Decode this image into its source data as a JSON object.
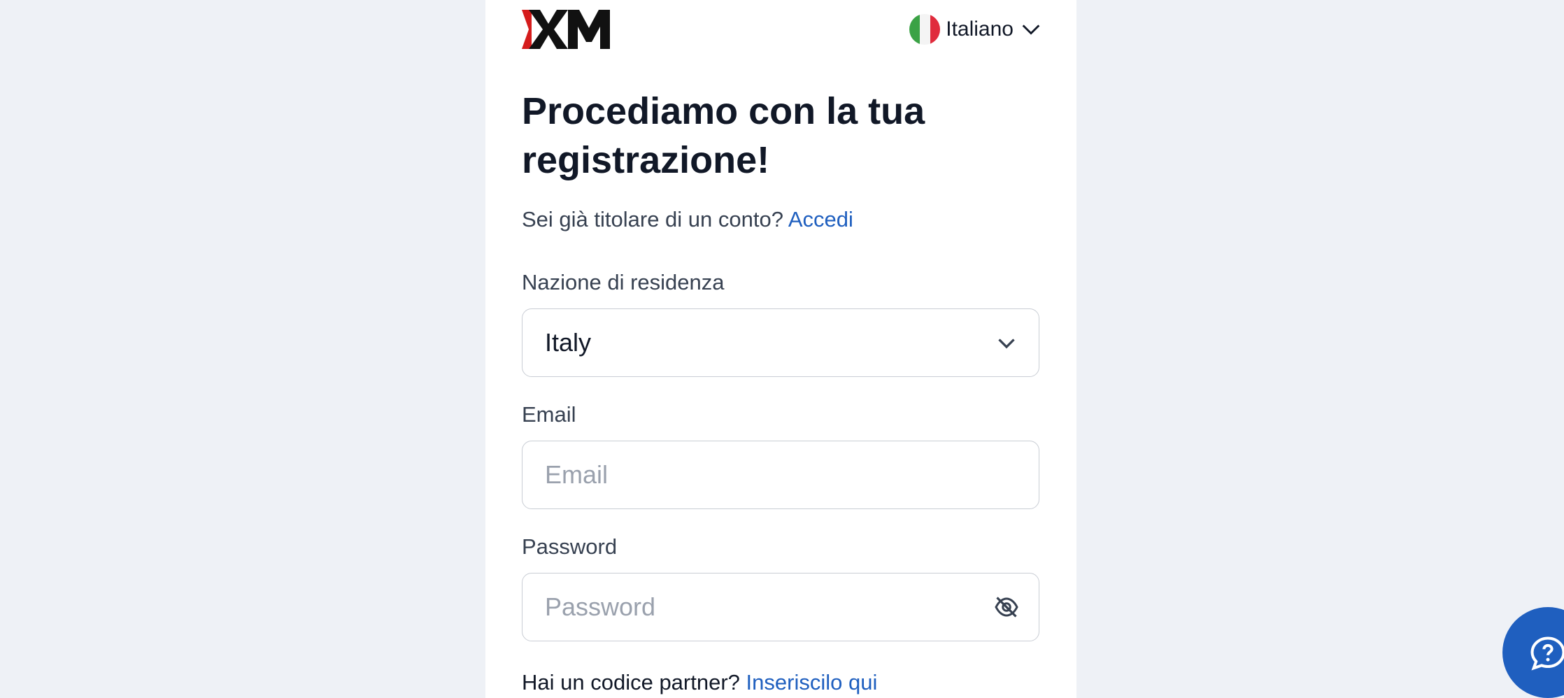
{
  "header": {
    "logo_text": "XM",
    "language_label": "Italiano",
    "colors": {
      "flag_green": "#3aa245",
      "flag_white": "#f4f4f4",
      "flag_red": "#e02b3c",
      "logo_red": "#d51c1c"
    }
  },
  "main": {
    "title": "Procediamo con la tua registrazione!",
    "signin_prompt": "Sei già titolare di un conto?",
    "signin_link": "Accedi",
    "country": {
      "label": "Nazione di residenza",
      "value": "Italy",
      "icon": "chevron-down-icon"
    },
    "email": {
      "label": "Email",
      "placeholder": "Email"
    },
    "password": {
      "label": "Password",
      "placeholder": "Password",
      "icon": "eye-slash-icon"
    },
    "partner_prompt": "Hai un codice partner?",
    "partner_link": "Inseriscilo qui"
  },
  "help_widget": {
    "icon": "help-chat-icon",
    "color": "#1f5fbf"
  }
}
